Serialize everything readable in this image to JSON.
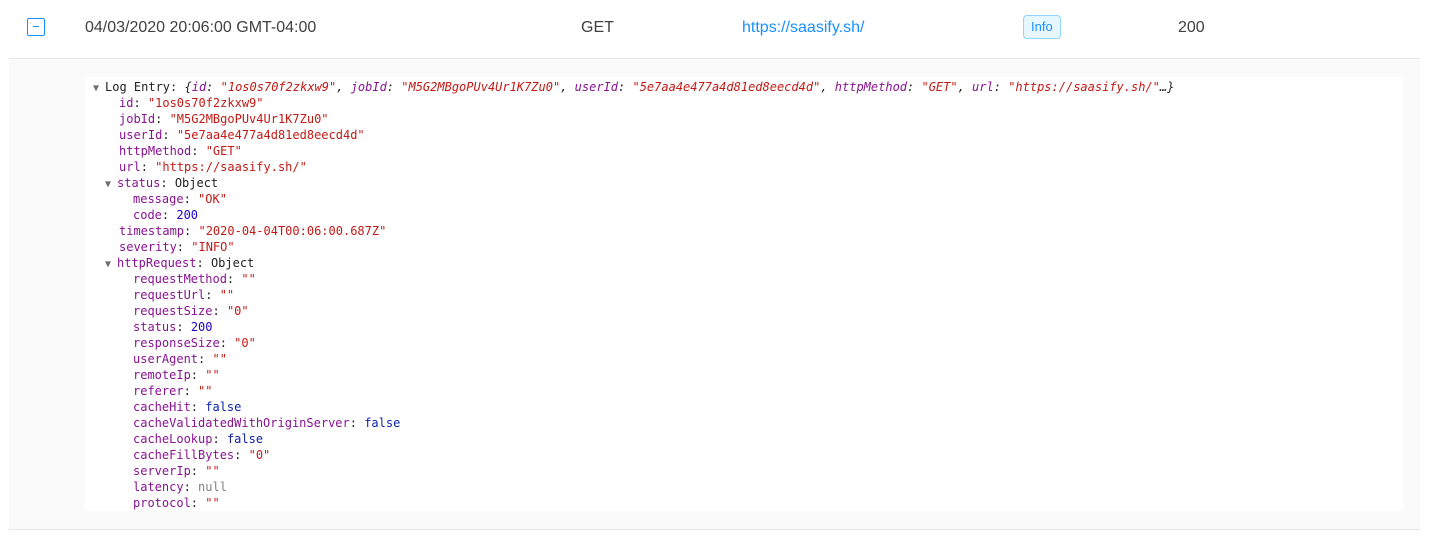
{
  "row": {
    "date": "04/03/2020 20:06:00 GMT-04:00",
    "method": "GET",
    "url": "https://saasify.sh/",
    "severity_badge": "Info",
    "status": "200"
  },
  "inspector": {
    "root_label": "Log Entry",
    "summary": {
      "open": "{",
      "entries": [
        {
          "key": "id",
          "value": "\"1os0s70f2zkxw9\""
        },
        {
          "key": "jobId",
          "value": "\"M5G2MBgoPUv4Ur1K7Zu0\""
        },
        {
          "key": "userId",
          "value": "\"5e7aa4e477a4d81ed8eecd4d\""
        },
        {
          "key": "httpMethod",
          "value": "\"GET\""
        },
        {
          "key": "url",
          "value": "\"https://saasify.sh/\""
        }
      ],
      "close": "…}"
    },
    "fields": {
      "id": {
        "key": "id",
        "value": "\"1os0s70f2zkxw9\""
      },
      "jobId": {
        "key": "jobId",
        "value": "\"M5G2MBgoPUv4Ur1K7Zu0\""
      },
      "userId": {
        "key": "userId",
        "value": "\"5e7aa4e477a4d81ed8eecd4d\""
      },
      "httpMethod": {
        "key": "httpMethod",
        "value": "\"GET\""
      },
      "url": {
        "key": "url",
        "value": "\"https://saasify.sh/\""
      },
      "status": {
        "key": "status",
        "value": "Object"
      },
      "status_message": {
        "key": "message",
        "value": "\"OK\""
      },
      "status_code": {
        "key": "code",
        "value": "200"
      },
      "timestamp": {
        "key": "timestamp",
        "value": "\"2020-04-04T00:06:00.687Z\""
      },
      "severity": {
        "key": "severity",
        "value": "\"INFO\""
      },
      "httpRequest": {
        "key": "httpRequest",
        "value": "Object"
      },
      "requestMethod": {
        "key": "requestMethod",
        "value": "\"\""
      },
      "requestUrl": {
        "key": "requestUrl",
        "value": "\"\""
      },
      "requestSize": {
        "key": "requestSize",
        "value": "\"0\""
      },
      "req_status": {
        "key": "status",
        "value": "200"
      },
      "responseSize": {
        "key": "responseSize",
        "value": "\"0\""
      },
      "userAgent": {
        "key": "userAgent",
        "value": "\"\""
      },
      "remoteIp": {
        "key": "remoteIp",
        "value": "\"\""
      },
      "referer": {
        "key": "referer",
        "value": "\"\""
      },
      "cacheHit": {
        "key": "cacheHit",
        "value": "false"
      },
      "cacheValidatedWithOriginServer": {
        "key": "cacheValidatedWithOriginServer",
        "value": "false"
      },
      "cacheLookup": {
        "key": "cacheLookup",
        "value": "false"
      },
      "cacheFillBytes": {
        "key": "cacheFillBytes",
        "value": "\"0\""
      },
      "serverIp": {
        "key": "serverIp",
        "value": "\"\""
      },
      "latency": {
        "key": "latency",
        "value": "null"
      },
      "protocol": {
        "key": "protocol",
        "value": "\"\""
      }
    },
    "expand_glyph": "▼",
    "colors": {
      "key": "#881391",
      "string": "#c41a16",
      "number": "#1c00cf",
      "boolean": "#0d22aa",
      "null": "#808080",
      "link": "#1890ff"
    }
  }
}
